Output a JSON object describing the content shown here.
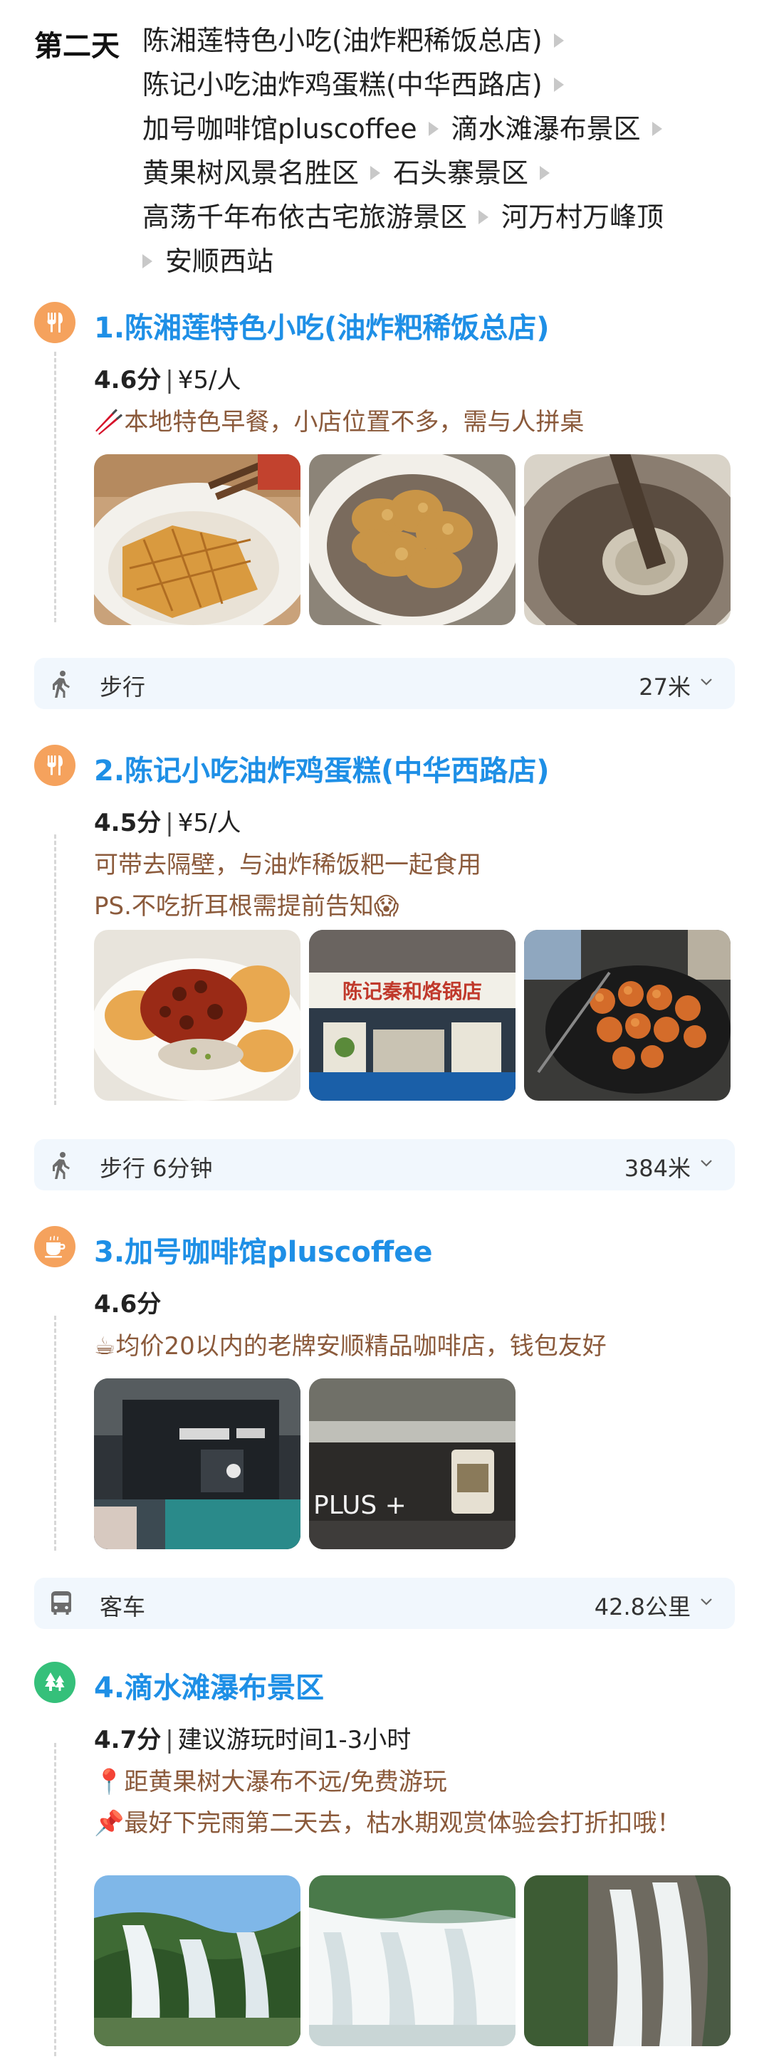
{
  "day": {
    "label": "第二天",
    "route": [
      "陈湘莲特色小吃(油炸粑稀饭总店)",
      "陈记小吃油炸鸡蛋糕(中华西路店)",
      "加号咖啡馆pluscoffee",
      "滴水滩瀑布景区",
      "黄果树风景名胜区",
      "石头寨景区",
      "高荡千年布依古宅旅游景区",
      "河万村万峰顶",
      "安顺西站"
    ]
  },
  "pois": [
    {
      "index": "1",
      "title": "1.陈湘莲特色小吃(油炸粑稀饭总店)",
      "rating": "4.6分",
      "extra": "¥5/人",
      "icon": "fork-knife-icon",
      "desc": [
        "🥢本地特色早餐，小店位置不多，需与人拼桌"
      ],
      "photos": [
        "fried-cake-bowl-photo",
        "fried-cake-plate-photo",
        "frying-pot-photo"
      ]
    },
    {
      "index": "2",
      "title": "2.陈记小吃油炸鸡蛋糕(中华西路店)",
      "rating": "4.5分",
      "extra": "¥5/人",
      "icon": "fork-knife-icon",
      "desc": [
        "可带去隔壁，与油炸稀饭粑一起食用",
        "PS.不吃折耳根需提前告知😱"
      ],
      "photos": [
        "egg-cake-dish-photo",
        "shop-front-photo",
        "frying-griddle-photo"
      ],
      "sign_text": "陈记秦和烙锅店"
    },
    {
      "index": "3",
      "title": "3.加号咖啡馆pluscoffee",
      "rating": "4.6分",
      "extra": "",
      "icon": "coffee-cup-icon",
      "desc": [
        "☕均价20以内的老牌安顺精品咖啡店，钱包友好"
      ],
      "photos": [
        "street-night-photo",
        "cafe-sign-photo"
      ],
      "sign_text": "PLUS +"
    },
    {
      "index": "4",
      "title": "4.滴水滩瀑布景区",
      "rating": "4.7分",
      "extra": "建议游玩时间1-3小时",
      "icon": "trees-icon",
      "desc": [
        "📍距黄果树大瀑布不远/免费游玩",
        "📌最好下完雨第二天去，枯水期观赏体验会打折扣哦！"
      ],
      "photos": [
        "waterfall-valley-photo",
        "waterfall-wide-photo",
        "waterfall-cliff-photo"
      ]
    }
  ],
  "transports": [
    {
      "mode": "步行",
      "distance": "27米",
      "icon": "walking-person-icon"
    },
    {
      "mode": "步行 6分钟",
      "distance": "384米",
      "icon": "walking-person-icon"
    },
    {
      "mode": "客车",
      "distance": "42.8公里",
      "icon": "bus-icon"
    }
  ],
  "colors": {
    "accent_blue": "#1e8fe6",
    "food_orange": "#f5a25d",
    "scenic_green": "#35c07a",
    "desc_brown": "#8b5a3b",
    "transport_bg": "#f1f7fd"
  }
}
